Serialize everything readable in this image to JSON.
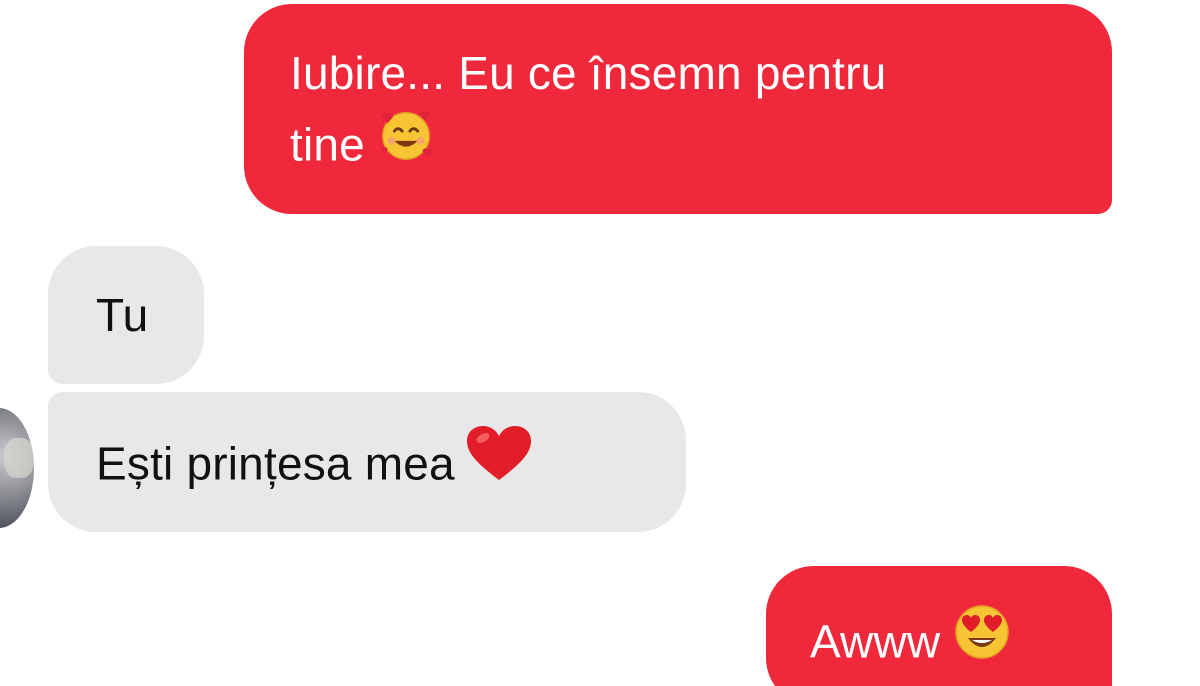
{
  "messages": [
    {
      "direction": "sent",
      "lines": [
        "Iubire... Eu ce însemn pentru",
        "tine"
      ],
      "emoji": "smiling-face-with-hearts"
    },
    {
      "direction": "received",
      "text": "Tu"
    },
    {
      "direction": "received",
      "text": "Ești prințesa mea",
      "emoji": "red-heart"
    },
    {
      "direction": "sent",
      "text": "Awww",
      "emoji": "heart-eyes"
    }
  ],
  "colors": {
    "sent_bubble": "#f0283c",
    "received_bubble": "#e8e8e8",
    "sent_text": "#ffffff",
    "received_text": "#111111",
    "background": "#ffffff"
  }
}
